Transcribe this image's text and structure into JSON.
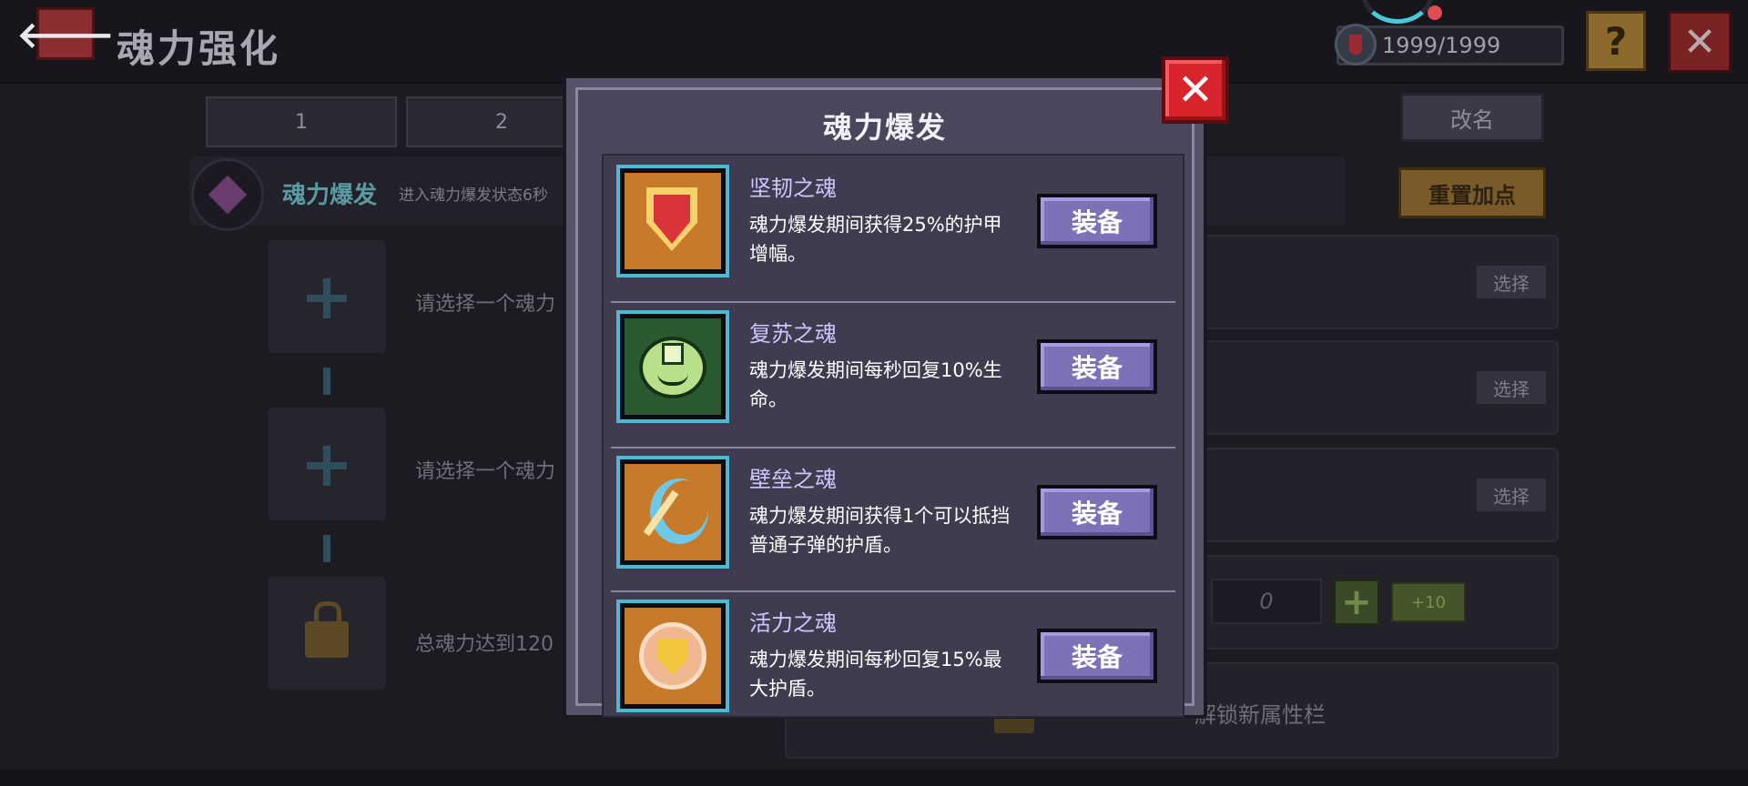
{
  "screen": {
    "title": "魂力强化",
    "energy": "1999/1999",
    "help_symbol": "?",
    "close_symbol": "✕",
    "back_symbol": "🡐"
  },
  "tabs": [
    {
      "label": "1"
    },
    {
      "label": "2"
    }
  ],
  "buttons": {
    "rename": "改名",
    "reset": "重置加点",
    "choose": "选择",
    "plus": "+",
    "plus10": "+10"
  },
  "burst": {
    "label": "魂力爆发",
    "desc": "进入魂力爆发状态6秒"
  },
  "slots": [
    {
      "text": "请选择一个魂力"
    },
    {
      "text": "请选择一个魂力"
    },
    {
      "text": "总魂力达到120"
    }
  ],
  "points_value": "0",
  "unlock_text": "解锁新属性栏",
  "modal": {
    "title": "魂力爆发",
    "close_symbol": "✕",
    "items": [
      {
        "name": "坚韧之魂",
        "desc": "魂力爆发期间获得25%的护甲增幅。",
        "button": "装备",
        "icon": "shield-icon"
      },
      {
        "name": "复苏之魂",
        "desc": "魂力爆发期间每秒回复10%生命。",
        "button": "装备",
        "icon": "healing-blob-icon"
      },
      {
        "name": "壁垒之魂",
        "desc": "魂力爆发期间获得1个可以抵挡普通子弹的护盾。",
        "button": "装备",
        "icon": "barrier-icon"
      },
      {
        "name": "活力之魂",
        "desc": "魂力爆发期间每秒回复15%最大护盾。",
        "button": "装备",
        "icon": "vitality-shield-icon"
      }
    ]
  },
  "colors": {
    "equip_button": "#7d72b8",
    "close_red": "#d8242a",
    "item_name": "#cfc6ff",
    "icon_border": "#4db8d4"
  }
}
